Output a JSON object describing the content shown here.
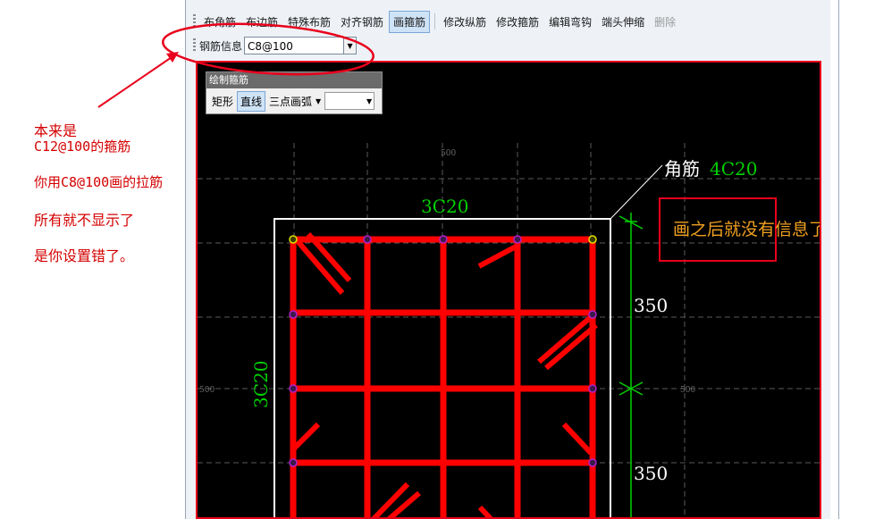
{
  "annotations": {
    "line1": "本来是",
    "line2": "C12@100的箍筋",
    "line3": "你用C8@100画的拉筋",
    "line4": "所有就不显示了",
    "line5": "是你设置错了。",
    "after_draw": "画之后就没有信息了"
  },
  "toolbar": {
    "buttons": [
      "布角筋",
      "布边筋",
      "特殊布筋",
      "对齐钢筋",
      "画箍筋",
      "修改纵筋",
      "修改箍筋",
      "编辑弯钩",
      "端头伸缩",
      "删除"
    ],
    "active": "画箍筋",
    "disabled": "删除"
  },
  "rebar_info": {
    "label": "钢筋信息",
    "value": "C8@100"
  },
  "draw_panel": {
    "title": "绘制箍筋",
    "rect": "矩形",
    "line": "直线",
    "arc": "三点画弧",
    "active": "直线"
  },
  "drawing": {
    "top_label": "3C20",
    "left_label": "3C20",
    "corner_label": "角筋",
    "corner_value": "4C20",
    "dim1": "350",
    "dim2": "350",
    "grid_top": "500",
    "grid_left": "500",
    "grid_right": "500",
    "colors": {
      "rebar": "#ff0000",
      "label": "#00d000",
      "white": "#ffffff"
    }
  }
}
